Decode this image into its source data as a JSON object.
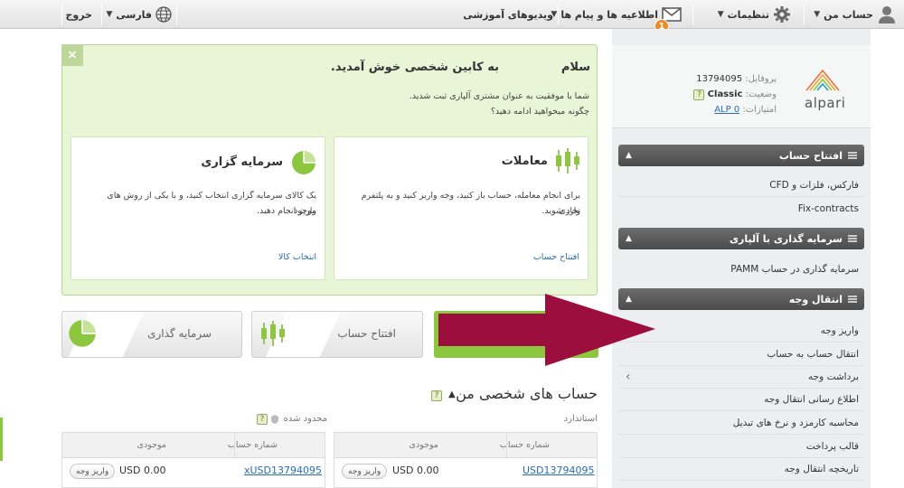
{
  "topbar": {
    "account": "حساب من",
    "settings": "تنظیمات",
    "notifications": "اطلاعیه ها و پیام ها",
    "notification_count": "1",
    "videos": "ویدیوهای آموزشی",
    "language": "فارسی",
    "logout": "خروج"
  },
  "profile": {
    "portfolio_label": "پروفایل:",
    "portfolio_value": "13794095",
    "status_label": "وضعیت:",
    "status_value": "Classic",
    "points_label": "امتیازات:",
    "points_value": "ALP 0",
    "logo": "alpari"
  },
  "sidebar": {
    "sections": [
      {
        "title": "افتتاح حساب",
        "items": [
          "فارکس، فلزات و CFD",
          "Fix-contracts"
        ]
      },
      {
        "title": "سرمایه گذاری با آلپاری",
        "items": [
          "سرمایه گذاری در حساب PAMM"
        ]
      },
      {
        "title": "انتقال وجه",
        "items": [
          "واریز وجه",
          "انتقال حساب به حساب",
          "برداشت وجه",
          "اطلاع رسانی انتقال وجه",
          "محاسبه کارمزد و نرخ های تبدیل",
          "قالب پرداخت",
          "تاریخچه انتقال وجه"
        ]
      }
    ]
  },
  "welcome": {
    "close": "×",
    "greeting": "سلام",
    "title": "به کابین شخصی خوش آمدید.",
    "line1": "شما با موفقیت به عنوان مشتری آلپاری ثبت شدید.",
    "line2": "چگونه میخواهید ادامه دهید؟",
    "trading_card": {
      "title": "معاملات",
      "text1": "برای انجام معامله، حساب باز کنید، وجه واریز کنید و به پلتفرم تجاری",
      "text2": "وارد شوید.",
      "link": "افتتاح حساب"
    },
    "invest_card": {
      "title": "سرمایه گزاری",
      "text1": "یک کالای سرمایه گزاری انتخاب کنید، و با یکی از روش های موجود",
      "text2": "واریز انجام دهید.",
      "link": "انتخاب کالا"
    }
  },
  "tabs": {
    "open_account": "افتتاح حساب",
    "invest": "سرمایه گذاری"
  },
  "accounts": {
    "title": "حساب های شخصی من",
    "standard_label": "استاندارد",
    "limited_label": "محدود شده",
    "col_account": "شماره حساب",
    "col_balance": "موجودی",
    "standard_account": "USD13794095",
    "standard_balance": "USD 0.00",
    "limited_account": "xUSD13794095",
    "limited_balance": "USD 0.00",
    "deposit": "واریز وجه"
  },
  "colors": {
    "accent_green": "#8dc63f",
    "arrow": "#9b0e3d",
    "link": "#2a6db5"
  }
}
